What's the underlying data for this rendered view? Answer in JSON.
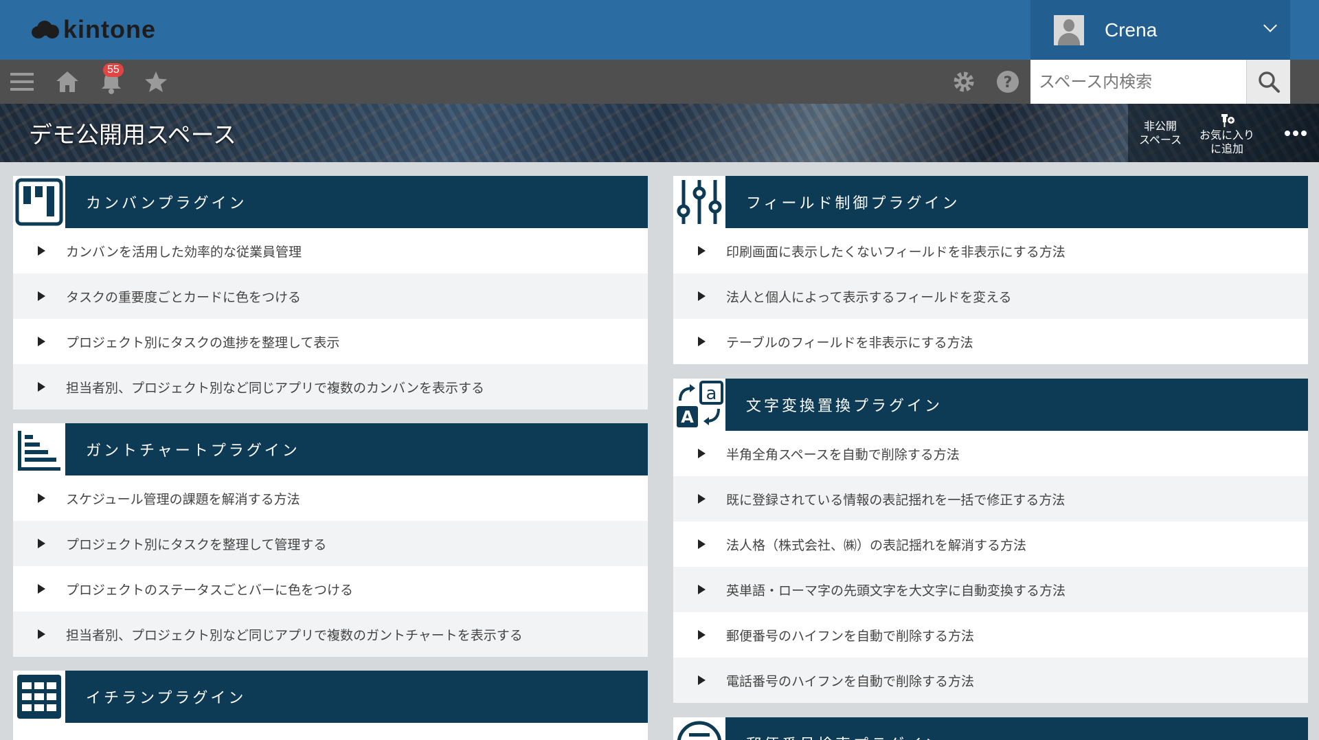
{
  "header": {
    "logo_text": "kintone",
    "user_name": "Crena"
  },
  "toolbar": {
    "notification_count": "55",
    "search_placeholder": "スペース内検索"
  },
  "banner": {
    "space_title": "デモ公開用スペース",
    "private_label_1": "非公開",
    "private_label_2": "スペース",
    "favorite_label_1": "お気に入り",
    "favorite_label_2": "に追加"
  },
  "panels": [
    {
      "title": "カンバンプラグイン",
      "icon": "kanban-icon",
      "items": [
        "カンバンを活用した効率的な従業員管理",
        "タスクの重要度ごとカードに色をつける",
        "プロジェクト別にタスクの進捗を整理して表示",
        "担当者別、プロジェクト別など同じアプリで複数のカンバンを表示する"
      ]
    },
    {
      "title": "ガントチャートプラグイン",
      "icon": "gantt-chart-icon",
      "items": [
        "スケジュール管理の課題を解消する方法",
        "プロジェクト別にタスクを整理して管理する",
        "プロジェクトのステータスごとバーに色をつける",
        "担当者別、プロジェクト別など同じアプリで複数のガントチャートを表示する"
      ]
    },
    {
      "title": "イチランプラグイン",
      "icon": "grid-list-icon",
      "items": []
    },
    {
      "title": "フィールド制御プラグイン",
      "icon": "sliders-icon",
      "items": [
        "印刷画面に表示したくないフィールドを非表示にする方法",
        "法人と個人によって表示するフィールドを変える",
        "テーブルのフィールドを非表示にする方法"
      ]
    },
    {
      "title": "文字変換置換プラグイン",
      "icon": "text-convert-icon",
      "items": [
        "半角全角スペースを自動で削除する方法",
        "既に登録されている情報の表記揺れを一括で修正する方法",
        "法人格（株式会社、㈱）の表記揺れを解消する方法",
        "英単語・ローマ字の先頭文字を大文字に自動変換する方法",
        "郵便番号のハイフンを自動で削除する方法",
        "電話番号のハイフンを自動で削除する方法"
      ]
    },
    {
      "title": "郵便番号検索プラグイン",
      "icon": "postal-search-icon",
      "items": []
    }
  ]
}
